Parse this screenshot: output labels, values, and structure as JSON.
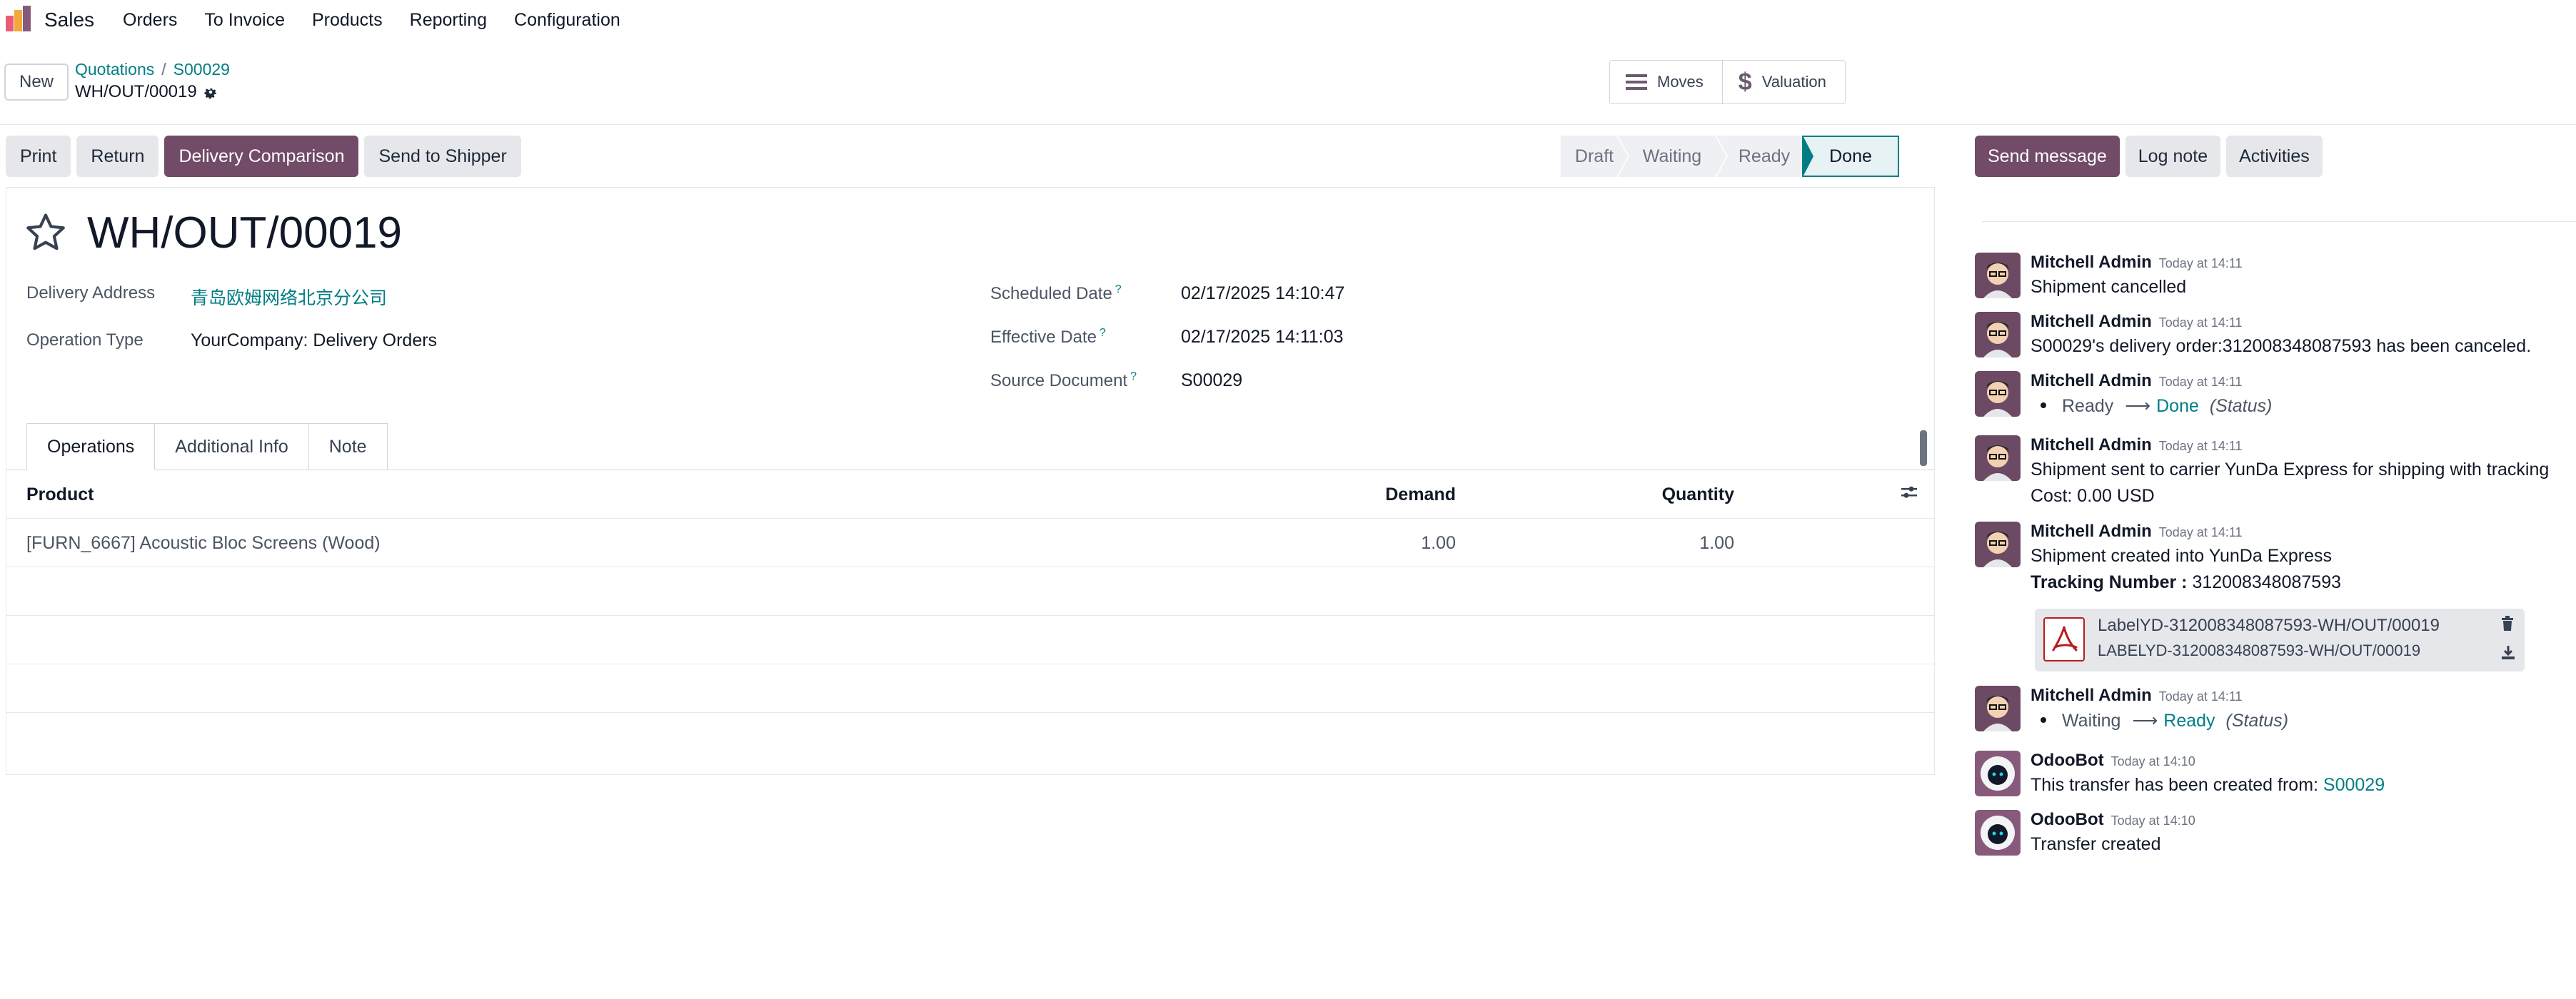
{
  "app": {
    "name": "Sales",
    "menu": [
      "Orders",
      "To Invoice",
      "Products",
      "Reporting",
      "Configuration"
    ]
  },
  "control_panel": {
    "new_label": "New",
    "breadcrumb": [
      "Quotations",
      "S00029"
    ],
    "current_record": "WH/OUT/00019",
    "smart_buttons": [
      {
        "label": "Moves",
        "icon": "list-icon"
      },
      {
        "label": "Valuation",
        "icon": "dollar-icon"
      }
    ]
  },
  "actions": [
    "Print",
    "Return",
    "Delivery Comparison",
    "Send to Shipper"
  ],
  "status_steps": [
    "Draft",
    "Waiting",
    "Ready",
    "Done"
  ],
  "status_current": "Done",
  "record": {
    "title": "WH/OUT/00019",
    "fields_left": [
      {
        "label": "Delivery Address",
        "value": "青岛欧姆网络北京分公司"
      },
      {
        "label": "Operation Type",
        "value": "YourCompany: Delivery Orders"
      }
    ],
    "fields_right": [
      {
        "label": "Scheduled Date",
        "help": "?",
        "value": "02/17/2025 14:10:47"
      },
      {
        "label": "Effective Date",
        "help": "?",
        "value": "02/17/2025 14:11:03"
      },
      {
        "label": "Source Document",
        "help": "?",
        "value": "S00029"
      }
    ]
  },
  "tabs": [
    "Operations",
    "Additional Info",
    "Note"
  ],
  "table": {
    "headers": [
      "Product",
      "Demand",
      "Quantity"
    ],
    "rows": [
      {
        "product": "[FURN_6667] Acoustic Bloc Screens (Wood)",
        "demand": "1.00",
        "quantity": "1.00"
      }
    ]
  },
  "chatter": {
    "buttons": [
      "Send message",
      "Log note",
      "Activities"
    ],
    "messages": [
      {
        "author": "Mitchell Admin",
        "time": "Today at 14:11",
        "lines": [
          "Shipment cancelled"
        ]
      },
      {
        "author": "Mitchell Admin",
        "time": "Today at 14:11",
        "lines": [
          "S00029's delivery order:312008348087593 has been canceled."
        ]
      },
      {
        "author": "Mitchell Admin",
        "time": "Today at 14:11",
        "tracking": {
          "from": "Ready",
          "to": "Done",
          "field": "(Status)"
        }
      },
      {
        "author": "Mitchell Admin",
        "time": "Today at 14:11",
        "lines": [
          "Shipment sent to carrier YunDa Express for shipping with tracking",
          "Cost: 0.00 USD"
        ]
      },
      {
        "author": "Mitchell Admin",
        "time": "Today at 14:11",
        "lines": [
          "Shipment created into YunDa Express"
        ],
        "tracking_label": "Tracking Number :",
        "tracking_number": "312008348087593",
        "attachment": {
          "name": "LabelYD-312008348087593-WH/OUT/00019",
          "sub": "LABELYD-312008348087593-WH/OUT/00019"
        }
      },
      {
        "author": "Mitchell Admin",
        "time": "Today at 14:11",
        "tracking": {
          "from": "Waiting",
          "to": "Ready",
          "field": "(Status)"
        }
      },
      {
        "author": "OdooBot",
        "time": "Today at 14:10",
        "text_prefix": "This transfer has been created from:",
        "link": "S00029"
      },
      {
        "author": "OdooBot",
        "time": "Today at 14:10",
        "lines": [
          "Transfer created"
        ]
      }
    ]
  },
  "colors": {
    "brand": "#714b67",
    "teal": "#017e84"
  }
}
